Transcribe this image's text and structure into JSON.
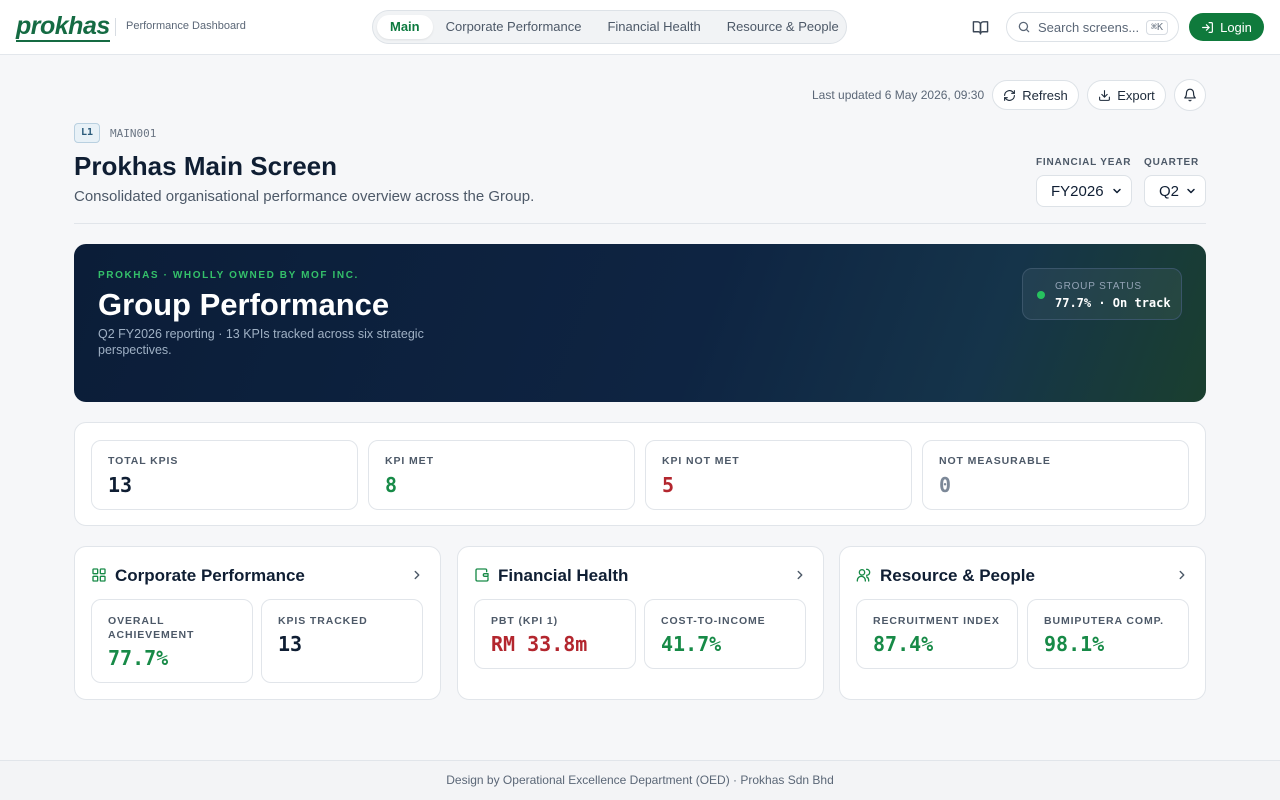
{
  "header": {
    "logo": "prokhas",
    "subtitle": "Performance Dashboard",
    "nav": [
      "Main",
      "Corporate Performance",
      "Financial Health",
      "Resource & People"
    ],
    "search_placeholder": "Search screens...",
    "search_shortcut": "⌘K",
    "login_label": "Login"
  },
  "toolbar": {
    "last_updated": "Last updated 6 May 2026, 09:30",
    "refresh_label": "Refresh",
    "export_label": "Export"
  },
  "page": {
    "level": "L1",
    "code": "MAIN001",
    "title": "Prokhas Main Screen",
    "subtitle": "Consolidated organisational performance overview across the Group.",
    "fy_label": "FINANCIAL YEAR",
    "fy_value": "FY2026",
    "quarter_label": "QUARTER",
    "quarter_value": "Q2"
  },
  "hero": {
    "eyebrow": "PROKHAS · WHOLLY OWNED BY MOF INC.",
    "title": "Group Performance",
    "description": "Q2 FY2026 reporting · 13 KPIs tracked across six strategic perspectives.",
    "status_label": "GROUP STATUS",
    "status_value": "77.7% · On track",
    "status_color": "#27c25f"
  },
  "kpis": [
    {
      "label": "TOTAL KPIS",
      "value": "13",
      "color": "#0f1e33"
    },
    {
      "label": "KPI MET",
      "value": "8",
      "color": "#178a47"
    },
    {
      "label": "KPI NOT MET",
      "value": "5",
      "color": "#b3262e"
    },
    {
      "label": "NOT MEASURABLE",
      "value": "0",
      "color": "#7c8898"
    }
  ],
  "sections": [
    {
      "title": "Corporate Performance",
      "metrics": [
        {
          "label": "OVERALL ACHIEVEMENT",
          "value": "77.7%",
          "color": "#178a47"
        },
        {
          "label": "KPIS TRACKED",
          "value": "13",
          "color": "#0f1e33"
        }
      ]
    },
    {
      "title": "Financial Health",
      "metrics": [
        {
          "label": "PBT (KPI 1)",
          "value": "RM 33.8m",
          "color": "#b3262e"
        },
        {
          "label": "COST-TO-INCOME",
          "value": "41.7%",
          "color": "#178a47"
        }
      ]
    },
    {
      "title": "Resource & People",
      "metrics": [
        {
          "label": "RECRUITMENT INDEX",
          "value": "87.4%",
          "color": "#178a47"
        },
        {
          "label": "BUMIPUTERA COMP.",
          "value": "98.1%",
          "color": "#178a47"
        }
      ]
    }
  ],
  "footer": {
    "text": "Design by Operational Excellence Department (OED) · Prokhas Sdn Bhd"
  }
}
